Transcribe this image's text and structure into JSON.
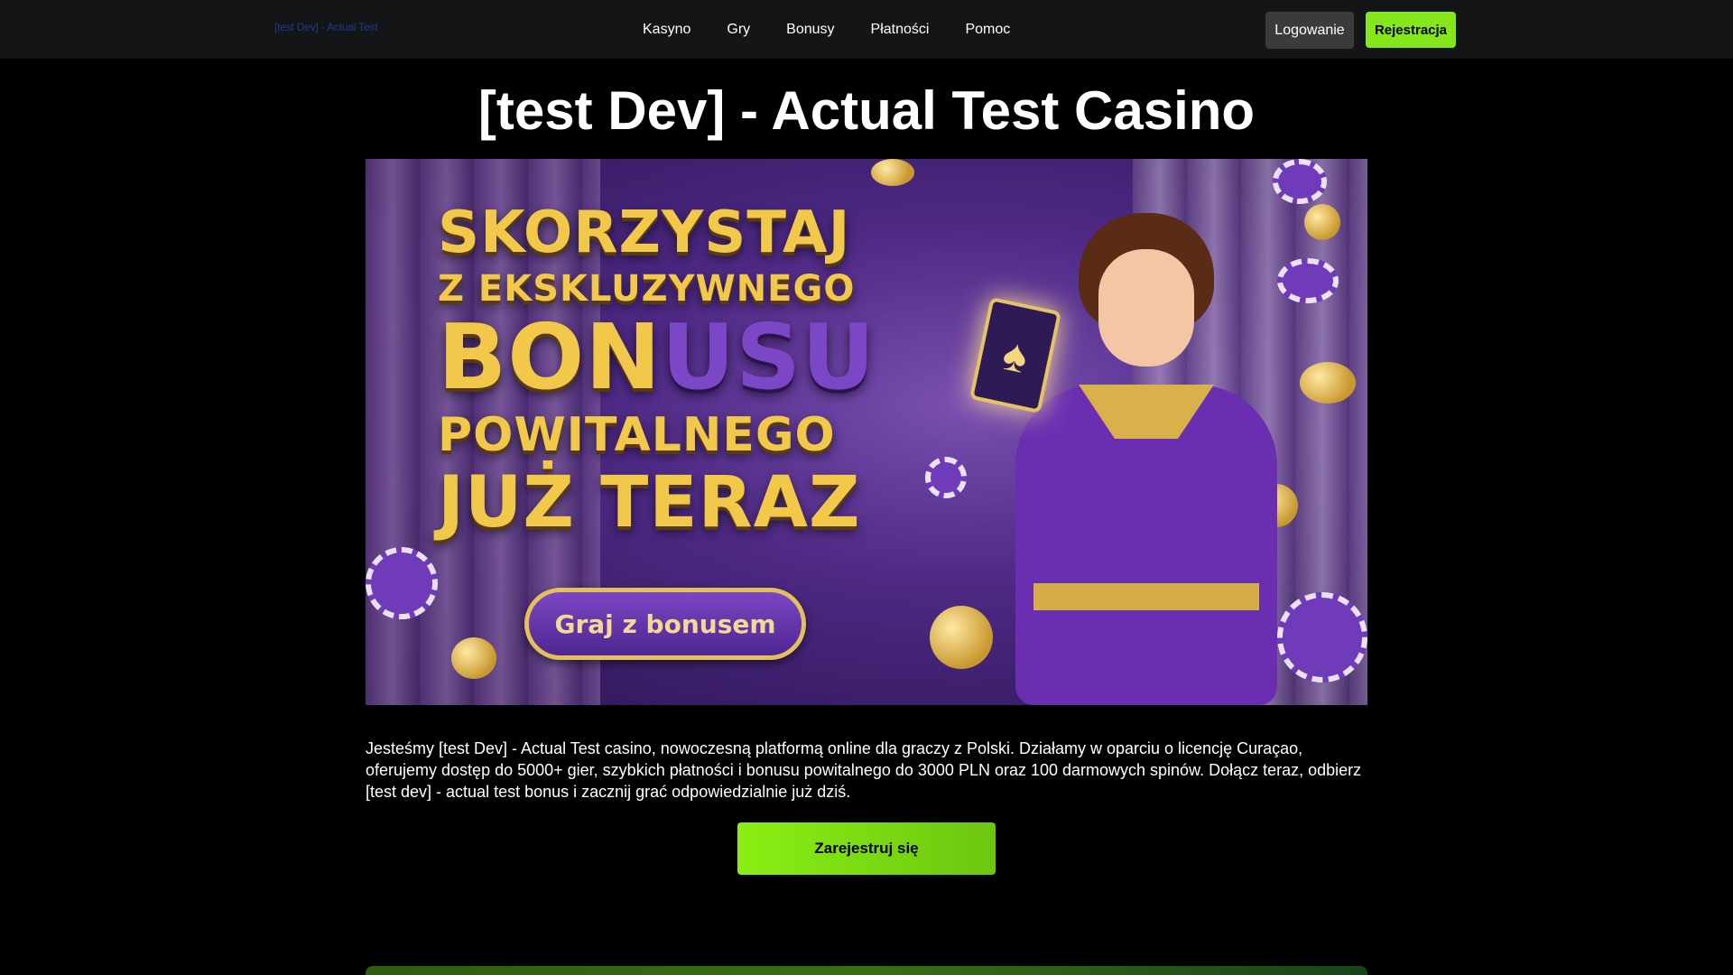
{
  "header": {
    "brand": "[test Dev] - Actual Test",
    "nav": [
      {
        "label": "Kasyno"
      },
      {
        "label": "Gry"
      },
      {
        "label": "Bonusy"
      },
      {
        "label": "Płatności"
      },
      {
        "label": "Pomoc"
      }
    ],
    "login_label": "Logowanie",
    "register_label": "Rejestracja"
  },
  "main": {
    "title": "[test Dev] - Actual Test Casino",
    "banner": {
      "line1": "SKORZYSTAJ",
      "line2": "Z EKSKLUZYWNEGO",
      "line3a": "BON",
      "line3b": "USU",
      "line4": "POWITALNEGO",
      "line5": "JUŻ TERAZ",
      "cta_label": "Graj z bonusem",
      "card_glyph": "♠"
    },
    "intro": "Jesteśmy [test Dev] - Actual Test casino, nowoczesną platformą online dla graczy z Polski. Działamy w oparciu o licencję Curaçao, oferujemy dostęp do 5000+ gier, szybkich płatności i bonusu powitalnego do 3000 PLN oraz 100 darmowych spinów. Dołącz teraz, odbierz [test dev] - actual test bonus i zacznij grać odpowiedzialnie już dziś.",
    "cta_label": "Zarejestruj się"
  },
  "colors": {
    "accent_green": "#84e61b",
    "header_bg": "#141517",
    "page_bg": "#000000",
    "banner_purple": "#6a2fb1",
    "banner_gold": "#f2c84b"
  }
}
